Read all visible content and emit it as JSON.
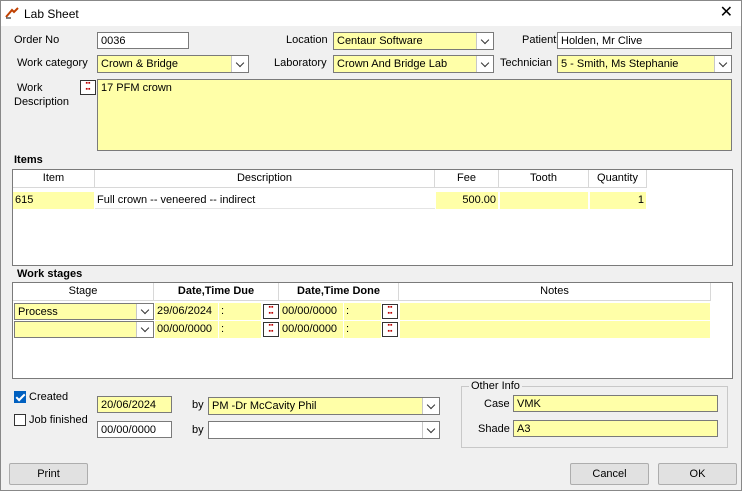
{
  "window": {
    "title": "Lab Sheet",
    "close_glyph": "✕"
  },
  "header": {
    "order_no_label": "Order No",
    "order_no_value": "0036",
    "location_label": "Location",
    "location_value": "Centaur Software",
    "patient_label": "Patient",
    "patient_value": "Holden, Mr Clive",
    "work_category_label": "Work category",
    "work_category_value": "Crown & Bridge",
    "laboratory_label": "Laboratory",
    "laboratory_value": "Crown And Bridge Lab",
    "technician_label": "Technician",
    "technician_value": "5 - Smith, Ms Stephanie",
    "work_desc_label_1": "Work",
    "work_desc_label_2": "Description",
    "work_desc_value": "17 PFM crown"
  },
  "items": {
    "section_label": "Items",
    "columns": [
      "Item",
      "Description",
      "Fee",
      "Tooth",
      "Quantity"
    ],
    "rows": [
      {
        "item": "615",
        "description": "Full crown -- veneered -- indirect",
        "fee": "500.00",
        "tooth": "",
        "quantity": "1"
      }
    ]
  },
  "work_stages": {
    "section_label": "Work stages",
    "columns": [
      "Stage",
      "Date,Time Due",
      "Date,Time Done",
      "Notes"
    ],
    "rows": [
      {
        "stage": "Process",
        "date_due": "29/06/2024",
        "time_due": " : ",
        "date_done": "00/00/0000",
        "time_done": " : ",
        "notes": ""
      },
      {
        "stage": "",
        "date_due": "00/00/0000",
        "time_due": " : ",
        "date_done": "00/00/0000",
        "time_done": " : ",
        "notes": ""
      }
    ]
  },
  "footer": {
    "created_label": "Created",
    "created_checked": true,
    "created_date": "20/06/2024",
    "created_by_label": "by",
    "created_by_value": "PM -Dr McCavity Phil",
    "job_finished_label": "Job finished",
    "job_finished_checked": false,
    "finished_date": "00/00/0000",
    "finished_by_label": "by",
    "finished_by_value": "",
    "other_info_label": "Other Info",
    "case_label": "Case",
    "case_value": "VMK",
    "shade_label": "Shade",
    "shade_value": "A3"
  },
  "buttons": {
    "print": "Print",
    "cancel": "Cancel",
    "ok": "OK"
  },
  "colors": {
    "field_yellow": "#ffffa8",
    "accent": "#0060c0"
  }
}
